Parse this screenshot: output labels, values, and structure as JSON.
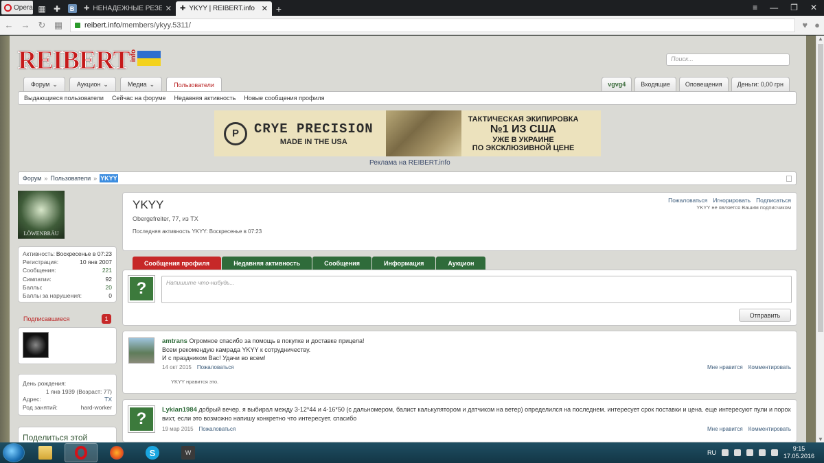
{
  "browser": {
    "opera_label": "Opera",
    "tabs": [
      {
        "title": "НЕНАДЕЖНЫЕ РЕЗЕРВИСТ",
        "active": false
      },
      {
        "title": "YKYY | REIBERT.info",
        "active": true
      }
    ],
    "new_tab": "+",
    "url_host": "reibert.info",
    "url_path": "/members/ykyy.5311/"
  },
  "site": {
    "logo_text": "REIBERT",
    "logo_suffix": "info",
    "search_placeholder": "Поиск...",
    "nav_tabs": [
      {
        "label": "Форум",
        "dropdown": true
      },
      {
        "label": "Аукцион",
        "dropdown": true
      },
      {
        "label": "Медиа",
        "dropdown": true
      },
      {
        "label": "Пользователи",
        "dropdown": false
      }
    ],
    "user_tabs": [
      "vgvg4",
      "Входящие",
      "Оповещения",
      "Деньги: 0,00 грн"
    ],
    "subnav": [
      "Выдающиеся пользователи",
      "Сейчас на форуме",
      "Недавняя активность",
      "Новые сообщения профиля"
    ]
  },
  "ad": {
    "brand": "CRYE PRECISION",
    "made": "MADE IN THE USA",
    "line1": "ТАКТИЧЕСКАЯ ЭКИПИРОВКА",
    "line2": "№1 ИЗ США",
    "line3": "УЖЕ В УКРАИНЕ",
    "line4": "ПО ЭКСКЛЮЗИВНОЙ ЦЕНЕ",
    "caption": "Реклама на REIBERT.info"
  },
  "breadcrumb": {
    "items": [
      "Форум",
      "Пользователи"
    ],
    "current": "YKYY"
  },
  "sidebar": {
    "avatar_text": "LÖWENBRÄU",
    "stats": [
      {
        "label": "Активность:",
        "value": "Воскресенье в 07:23"
      },
      {
        "label": "Регистрация:",
        "value": "10 янв 2007"
      },
      {
        "label": "Сообщения:",
        "value": "221"
      },
      {
        "label": "Симпатии:",
        "value": "92"
      },
      {
        "label": "Баллы:",
        "value": "20"
      },
      {
        "label": "Баллы за нарушения:",
        "value": "0"
      }
    ],
    "followers_label": "Подписавшиеся",
    "followers_count": "1",
    "birthday_label": "День рождения:",
    "birthday_value": "1 янв 1939 (Возраст: 77)",
    "address_label": "Адрес:",
    "address_value": "TX",
    "occupation_label": "Род занятий:",
    "occupation_value": "hard-worker",
    "share_label": "Поделиться этой"
  },
  "profile": {
    "name": "YKYY",
    "title": "Obergefreiter, 77, из TX",
    "last_seen": "Последняя активность YKYY: Воскресенье в 07:23",
    "actions": [
      "Пожаловаться",
      "Игнорировать",
      "Подписаться"
    ],
    "note": "YKYY не является Вашим подписчиком",
    "tabs": [
      "Сообщения профиля",
      "Недавняя активность",
      "Сообщения",
      "Информация",
      "Аукцион"
    ],
    "compose_placeholder": "Напишите что-нибудь...",
    "send_label": "Отправить"
  },
  "posts": [
    {
      "author": "amtrans",
      "lines": [
        "Огромное спасибо за помощь в покупке и доставке прицела!",
        "Всем рекомендую камрада YKYY к сотрудничеству.",
        "И с праздником Вас! Удачи во всем!"
      ],
      "date": "14 окт 2015",
      "report": "Пожаловаться",
      "like": "Мне нравится",
      "comment": "Комментировать",
      "likes_text": "YKYY нравится это."
    },
    {
      "author": "Lykian1984",
      "lines": [
        "добрый вечер. я выбирал между 3-12*44 и 4-16*50 (с дальномером, балист калькулятором и датчиком на ветер) определился на последнем. интересует срок поставки и цена. еще интересуют пули и порох вихт, если это возможно напишу конкретно что интересует. спасибо"
      ],
      "date": "19 мар 2015",
      "report": "Пожаловаться",
      "like": "Мне нравится",
      "comment": "Комментировать"
    }
  ],
  "taskbar": {
    "lang": "RU",
    "time": "9:15",
    "date": "17.05.2016"
  }
}
